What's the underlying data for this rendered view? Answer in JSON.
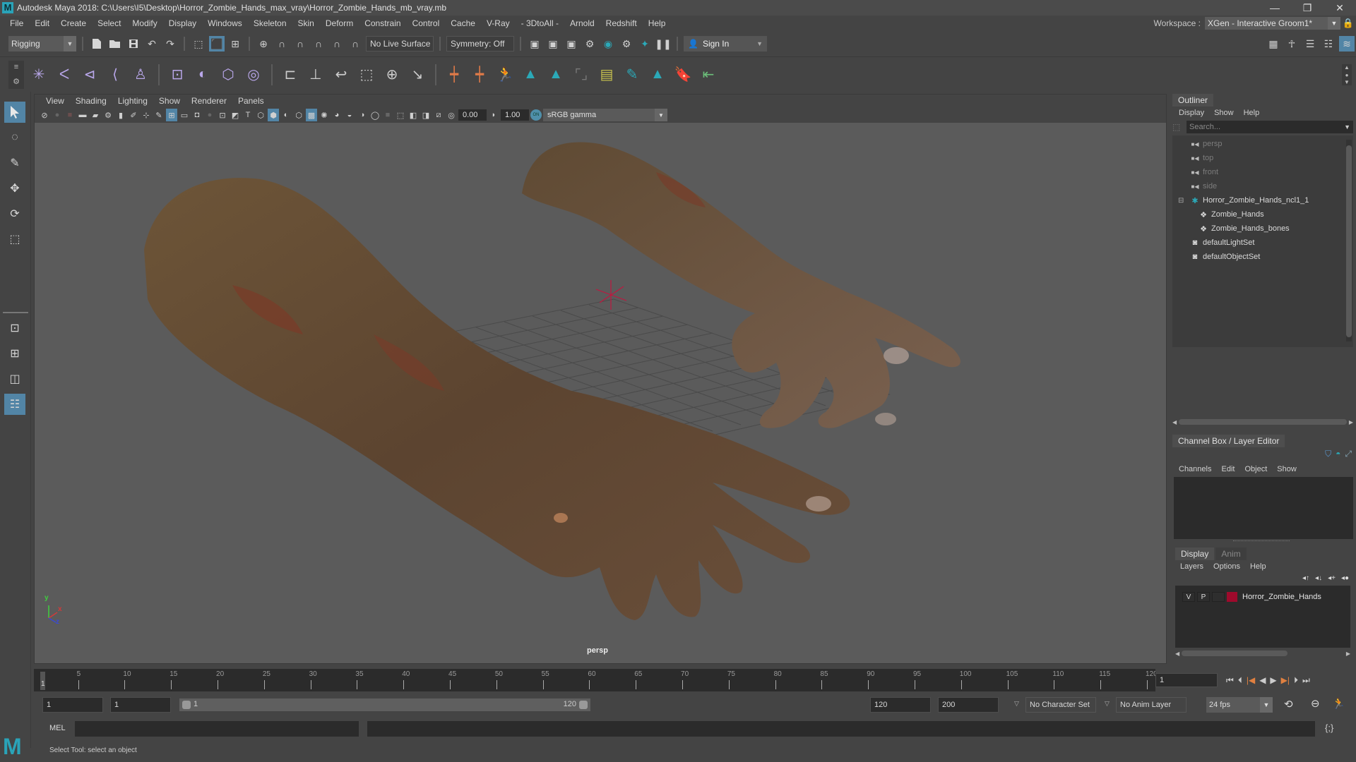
{
  "window": {
    "title": "Autodesk Maya 2018: C:\\Users\\I5\\Desktop\\Horror_Zombie_Hands_max_vray\\Horror_Zombie_Hands_mb_vray.mb",
    "minimize_glyph": "—",
    "maximize_glyph": "❐",
    "close_glyph": "✕"
  },
  "menubar": {
    "items": [
      "File",
      "Edit",
      "Create",
      "Select",
      "Modify",
      "Display",
      "Windows",
      "Skeleton",
      "Skin",
      "Deform",
      "Constrain",
      "Control",
      "Cache",
      "V-Ray",
      "- 3DtoAll -",
      "Arnold",
      "Redshift",
      "Help"
    ],
    "workspace_label": "Workspace :",
    "workspace_value": "XGen - Interactive Groom1*"
  },
  "statusline": {
    "menuset": "Rigging",
    "live_surface": "No Live Surface",
    "symmetry": "Symmetry: Off",
    "sign_in": "Sign In"
  },
  "viewport": {
    "menu": [
      "View",
      "Shading",
      "Lighting",
      "Show",
      "Renderer",
      "Panels"
    ],
    "exposure": "0.00",
    "gamma": "1.00",
    "color_management": "ON",
    "color_space": "sRGB gamma",
    "camera_label": "persp",
    "axis": {
      "x": "x",
      "y": "y",
      "z": "z"
    }
  },
  "outliner": {
    "tab": "Outliner",
    "menu": [
      "Display",
      "Show",
      "Help"
    ],
    "search_placeholder": "Search...",
    "items": [
      {
        "label": "persp",
        "icon": "camera-icon",
        "dim": true,
        "indent": 0
      },
      {
        "label": "top",
        "icon": "camera-icon",
        "dim": true,
        "indent": 0
      },
      {
        "label": "front",
        "icon": "camera-icon",
        "dim": true,
        "indent": 0
      },
      {
        "label": "side",
        "icon": "camera-icon",
        "dim": true,
        "indent": 0
      },
      {
        "label": "Horror_Zombie_Hands_ncl1_1",
        "icon": "joint-icon",
        "dim": false,
        "indent": 0,
        "expanded": true
      },
      {
        "label": "Zombie_Hands",
        "icon": "group-icon",
        "dim": false,
        "indent": 1
      },
      {
        "label": "Zombie_Hands_bones",
        "icon": "group-icon",
        "dim": false,
        "indent": 1
      },
      {
        "label": "defaultLightSet",
        "icon": "set-icon",
        "dim": false,
        "indent": 0
      },
      {
        "label": "defaultObjectSet",
        "icon": "set-icon",
        "dim": false,
        "indent": 0
      }
    ]
  },
  "channel_box": {
    "tab": "Channel Box / Layer Editor",
    "menu": [
      "Channels",
      "Edit",
      "Object",
      "Show"
    ]
  },
  "layer_editor": {
    "tabs": [
      "Display",
      "Anim"
    ],
    "active_tab": "Display",
    "menu": [
      "Layers",
      "Options",
      "Help"
    ],
    "layers": [
      {
        "visible": "V",
        "playback": "P",
        "name": "Horror_Zombie_Hands",
        "color": "#9e0a2c"
      }
    ]
  },
  "timeline": {
    "ticks": [
      5,
      10,
      15,
      20,
      25,
      30,
      35,
      40,
      45,
      50,
      55,
      60,
      65,
      70,
      75,
      80,
      85,
      90,
      95,
      100,
      105,
      110,
      115,
      120
    ],
    "start": 1,
    "end": 120,
    "current_frame_marker": "1",
    "current_frame": "1"
  },
  "range": {
    "start_time": "1",
    "playback_start": "1",
    "slider_min": "1",
    "slider_max": "120",
    "playback_end": "120",
    "end_time": "200",
    "character_set": "No Character Set",
    "anim_layer": "No Anim Layer",
    "fps": "24 fps"
  },
  "command_line": {
    "language": "MEL",
    "value": ""
  },
  "help_line": {
    "text": "Select Tool: select an object"
  },
  "colors": {
    "accent": "#5285a6",
    "teal": "#2ba9b8",
    "rig_violet": "#b9a7ea",
    "orange": "#e07a48",
    "layer_red": "#9e0a2c"
  }
}
